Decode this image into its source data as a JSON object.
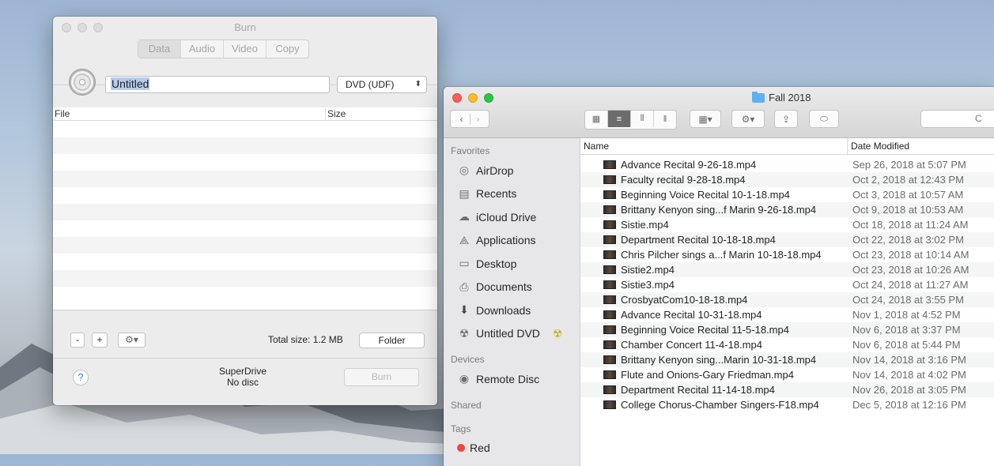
{
  "burn": {
    "title": "Burn",
    "tabs": [
      {
        "label": "Data",
        "selected": true
      },
      {
        "label": "Audio",
        "selected": false
      },
      {
        "label": "Video",
        "selected": false
      },
      {
        "label": "Copy",
        "selected": false
      }
    ],
    "disc_name": "Untitled",
    "filesystem": "DVD (UDF)",
    "columns": {
      "file": "File",
      "size": "Size"
    },
    "minus": "-",
    "plus": "+",
    "total_size": "Total size: 1.2 MB",
    "folder_label": "Folder",
    "help": "?",
    "drive_name": "SuperDrive",
    "drive_status": "No disc",
    "burn_label": "Burn"
  },
  "finder": {
    "title": "Fall 2018",
    "search_placeholder": "C",
    "sidebar": {
      "favorites_label": "Favorites",
      "favorites": [
        {
          "label": "AirDrop",
          "icon": "airdrop-icon"
        },
        {
          "label": "Recents",
          "icon": "recents-icon"
        },
        {
          "label": "iCloud Drive",
          "icon": "cloud-icon"
        },
        {
          "label": "Applications",
          "icon": "applications-icon"
        },
        {
          "label": "Desktop",
          "icon": "desktop-icon"
        },
        {
          "label": "Documents",
          "icon": "documents-icon"
        },
        {
          "label": "Downloads",
          "icon": "downloads-icon"
        },
        {
          "label": "Untitled DVD",
          "icon": "dvd-icon"
        }
      ],
      "devices_label": "Devices",
      "devices": [
        {
          "label": "Remote Disc",
          "icon": "remote-disc-icon"
        }
      ],
      "shared_label": "Shared",
      "tags_label": "Tags",
      "tags": [
        {
          "label": "Red",
          "color": "#f0473c"
        }
      ]
    },
    "columns": {
      "name": "Name",
      "date": "Date Modified"
    },
    "files": [
      {
        "name": "Advance Recital 9-26-18.mp4",
        "date": "Sep 26, 2018 at 5:07 PM"
      },
      {
        "name": "Faculty recital 9-28-18.mp4",
        "date": "Oct 2, 2018 at 12:43 PM"
      },
      {
        "name": "Beginning Voice Recital 10-1-18.mp4",
        "date": "Oct 3, 2018 at 10:57 AM"
      },
      {
        "name": "Brittany Kenyon sing...f Marin 9-26-18.mp4",
        "date": "Oct 9, 2018 at 10:53 AM"
      },
      {
        "name": "Sistie.mp4",
        "date": "Oct 18, 2018 at 11:24 AM"
      },
      {
        "name": "Department Recital 10-18-18.mp4",
        "date": "Oct 22, 2018 at 3:02 PM"
      },
      {
        "name": "Chris Pilcher sings a...f Marin 10-18-18.mp4",
        "date": "Oct 23, 2018 at 10:14 AM"
      },
      {
        "name": "Sistie2.mp4",
        "date": "Oct 23, 2018 at 10:26 AM"
      },
      {
        "name": "Sistie3.mp4",
        "date": "Oct 24, 2018 at 11:27 AM"
      },
      {
        "name": "CrosbyatCom10-18-18.mp4",
        "date": "Oct 24, 2018 at 3:55 PM"
      },
      {
        "name": "Advance Recital 10-31-18.mp4",
        "date": "Nov 1, 2018 at 4:52 PM"
      },
      {
        "name": "Beginning Voice Recital 11-5-18.mp4",
        "date": "Nov 6, 2018 at 3:37 PM"
      },
      {
        "name": "Chamber Concert 11-4-18.mp4",
        "date": "Nov 6, 2018 at 5:44 PM"
      },
      {
        "name": "Brittany Kenyon sing...Marin 10-31-18.mp4",
        "date": "Nov 14, 2018 at 3:16 PM"
      },
      {
        "name": "Flute and Onions-Gary Friedman.mp4",
        "date": "Nov 14, 2018 at 4:02 PM"
      },
      {
        "name": "Department Recital 11-14-18.mp4",
        "date": "Nov 26, 2018 at 3:05 PM"
      },
      {
        "name": "College Chorus-Chamber Singers-F18.mp4",
        "date": "Dec 5, 2018 at 12:16 PM"
      }
    ]
  }
}
